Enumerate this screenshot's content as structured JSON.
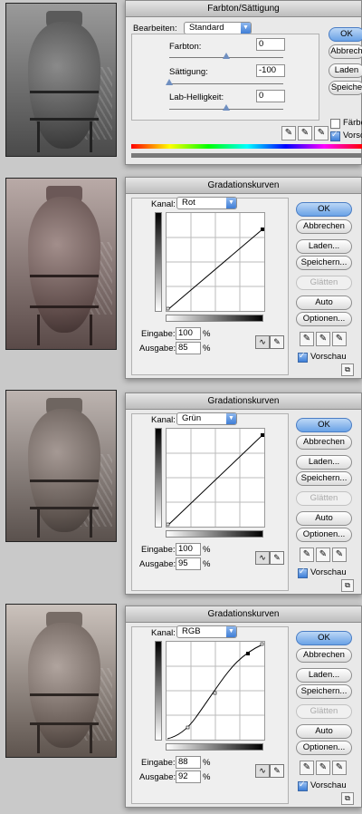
{
  "hs": {
    "title": "Farbton/Sättigung",
    "edit_label": "Bearbeiten:",
    "edit_value": "Standard",
    "hue_label": "Farbton:",
    "hue_value": "0",
    "sat_label": "Sättigung:",
    "sat_value": "-100",
    "light_label": "Lab-Helligkeit:",
    "light_value": "0",
    "buttons": [
      "OK",
      "Abbrech",
      "Laden",
      "Speiche"
    ],
    "colorize_label": "Färben",
    "preview_label": "Vorsch",
    "sat_level_pct": 0
  },
  "curves": [
    {
      "title": "Gradationskurven",
      "channel_label": "Kanal:",
      "channel_value": "Rot",
      "input_label": "Eingabe:",
      "input_value": "100",
      "output_label": "Ausgabe:",
      "output_value": "85",
      "unit": "%",
      "buttons": [
        "OK",
        "Abbrechen",
        "Laden...",
        "Speichern...",
        "Glätten",
        "Auto",
        "Optionen..."
      ],
      "preview_label": "Vorschau",
      "tint": "#6e5a58"
    },
    {
      "title": "Gradationskurven",
      "channel_label": "Kanal:",
      "channel_value": "Grün",
      "input_label": "Eingabe:",
      "input_value": "100",
      "output_label": "Ausgabe:",
      "output_value": "95",
      "unit": "%",
      "buttons": [
        "OK",
        "Abbrechen",
        "Laden...",
        "Speichern...",
        "Glätten",
        "Auto",
        "Optionen..."
      ],
      "preview_label": "Vorschau",
      "tint": "#6d625c"
    },
    {
      "title": "Gradationskurven",
      "channel_label": "Kanal:",
      "channel_value": "RGB",
      "input_label": "Eingabe:",
      "input_value": "88",
      "output_label": "Ausgabe:",
      "output_value": "92",
      "unit": "%",
      "buttons": [
        "OK",
        "Abbrechen",
        "Laden...",
        "Speichern...",
        "Glätten",
        "Auto",
        "Optionen..."
      ],
      "preview_label": "Vorschau",
      "tint": "#6a5e57"
    }
  ],
  "photo_gray_tint": "#6a6a6a"
}
